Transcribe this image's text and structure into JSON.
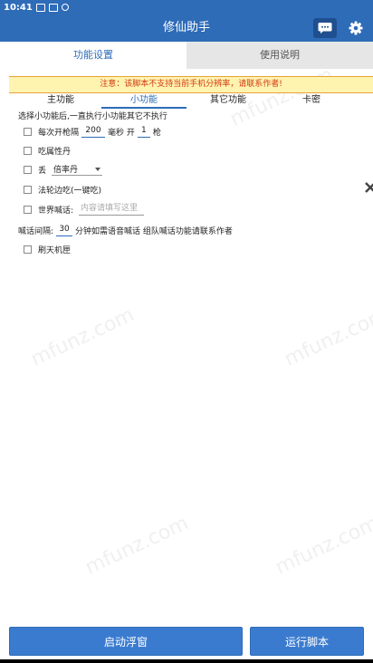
{
  "status_bar": {
    "time": "10:41"
  },
  "app_bar": {
    "title": "修仙助手"
  },
  "main_tabs": [
    {
      "label": "功能设置",
      "active": true
    },
    {
      "label": "使用说明",
      "active": false
    }
  ],
  "notice": "注意：该脚本不支持当前手机分辨率，请联系作者!",
  "sub_tabs": [
    {
      "label": "主功能",
      "active": false
    },
    {
      "label": "小功能",
      "active": true
    },
    {
      "label": "其它功能",
      "active": false
    },
    {
      "label": "卡密",
      "active": false
    }
  ],
  "hint": "选择小功能后,一直执行小功能其它不执行",
  "options": {
    "grab": {
      "label_prefix": "每次开枪隔",
      "interval": "200",
      "unit": "毫秒 开",
      "count": "1",
      "suffix": "枪",
      "checked": false
    },
    "eat_pill": {
      "label": "吃属性丹",
      "checked": false
    },
    "drop": {
      "label": "丢",
      "selected": "倍率丹",
      "checked": false
    },
    "kill_gate": {
      "label": "法轮边吃(一键吃)",
      "checked": false
    },
    "world_chat": {
      "label": "世界喊话:",
      "placeholder": "内容请填写这里",
      "checked": false
    },
    "refresh": {
      "label": "刷天机匣",
      "checked": false
    }
  },
  "shout": {
    "prefix": "喊话间隔:",
    "value": "30",
    "suffix": "分钟如需语音喊话 组队喊话功能请联系作者"
  },
  "buttons": {
    "float": "启动浮窗",
    "run": "运行脚本"
  },
  "watermark": "mfunz.com",
  "colors": {
    "primary": "#2e6cb8",
    "notice_bg": "#fff3b0",
    "notice_text": "#d03a10"
  }
}
